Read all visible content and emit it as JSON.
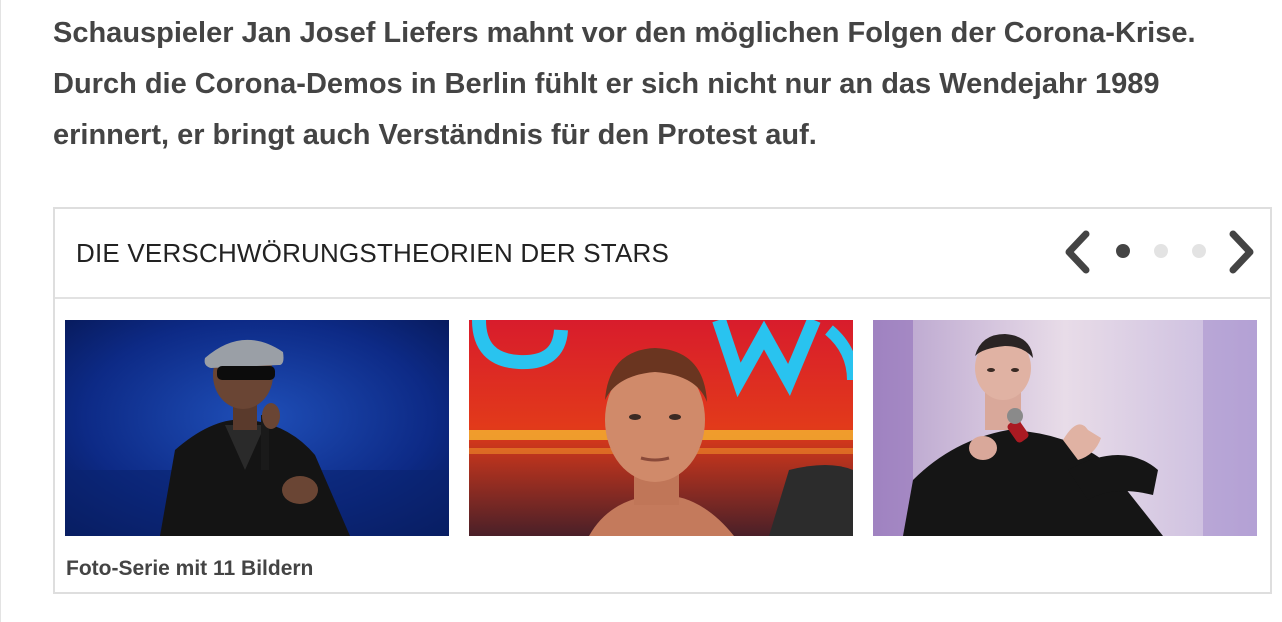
{
  "article": {
    "lead_text": "Schauspieler Jan Josef Liefers mahnt vor den möglichen Folgen der Corona-Krise. Durch die Corona-Demos in Berlin fühlt er sich nicht nur an das Wendejahr 1989 erinnert, er bringt auch Verständnis für den Protest auf."
  },
  "gallery": {
    "title": "DIE VERSCHWÖRUNGSTHEORIEN DER STARS",
    "caption": "Foto-Serie mit 11 Bildern",
    "pagination": {
      "total_pages": 3,
      "active_page": 1
    },
    "prev_icon": "chevron-left-icon",
    "next_icon": "chevron-right-icon",
    "colors": {
      "active_dot": "#444444",
      "inactive_dot": "#e3e3e3",
      "border": "#dedede",
      "text": "#444444"
    }
  }
}
